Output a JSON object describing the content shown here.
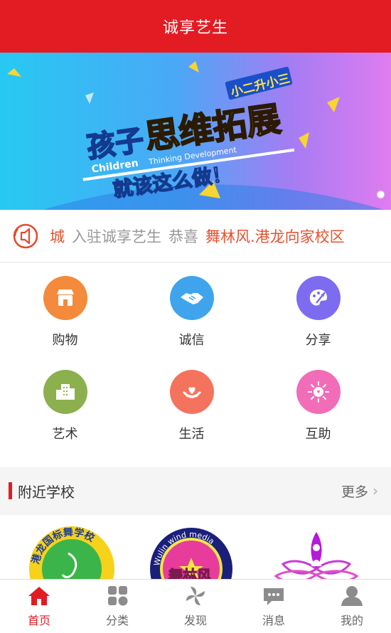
{
  "header": {
    "title": "诚享艺生"
  },
  "banner": {
    "badge": "小二升小三",
    "headline_a": "孩子",
    "headline_b": "思维拓展",
    "sub_en_a": "Children",
    "sub_en_b": "Thinking Development",
    "tagline": "就该这么做！"
  },
  "notice": {
    "part1": "城",
    "part2": "入驻诚享艺生",
    "part3": "恭喜",
    "part4": "舞林风.港龙向家校区"
  },
  "categories": [
    {
      "label": "购物",
      "icon": "store-icon",
      "color": "#f38a3c"
    },
    {
      "label": "诚信",
      "icon": "handshake-icon",
      "color": "#3fa4ec"
    },
    {
      "label": "分享",
      "icon": "palette-icon",
      "color": "#7d6cf0"
    },
    {
      "label": "艺术",
      "icon": "building-icon",
      "color": "#8bb04d"
    },
    {
      "label": "生活",
      "icon": "heart-hands-icon",
      "color": "#f4735d"
    },
    {
      "label": "互助",
      "icon": "sun-heart-icon",
      "color": "#f26db7"
    }
  ],
  "nearby": {
    "title": "附近学校",
    "more": "更多"
  },
  "schools": [
    {
      "logo_text": "港龙国标舞学校"
    },
    {
      "logo_text": "舞林风",
      "logo_sub": "Wulin wind media"
    },
    {
      "logo_text": ""
    }
  ],
  "tabs": [
    {
      "label": "首页",
      "icon": "home-icon",
      "active": true
    },
    {
      "label": "分类",
      "icon": "category-icon",
      "active": false
    },
    {
      "label": "发现",
      "icon": "pinwheel-icon",
      "active": false
    },
    {
      "label": "消息",
      "icon": "message-icon",
      "active": false
    },
    {
      "label": "我的",
      "icon": "profile-icon",
      "active": false
    }
  ],
  "colors": {
    "brand": "#e31b23",
    "notice_red": "#e8502e"
  }
}
